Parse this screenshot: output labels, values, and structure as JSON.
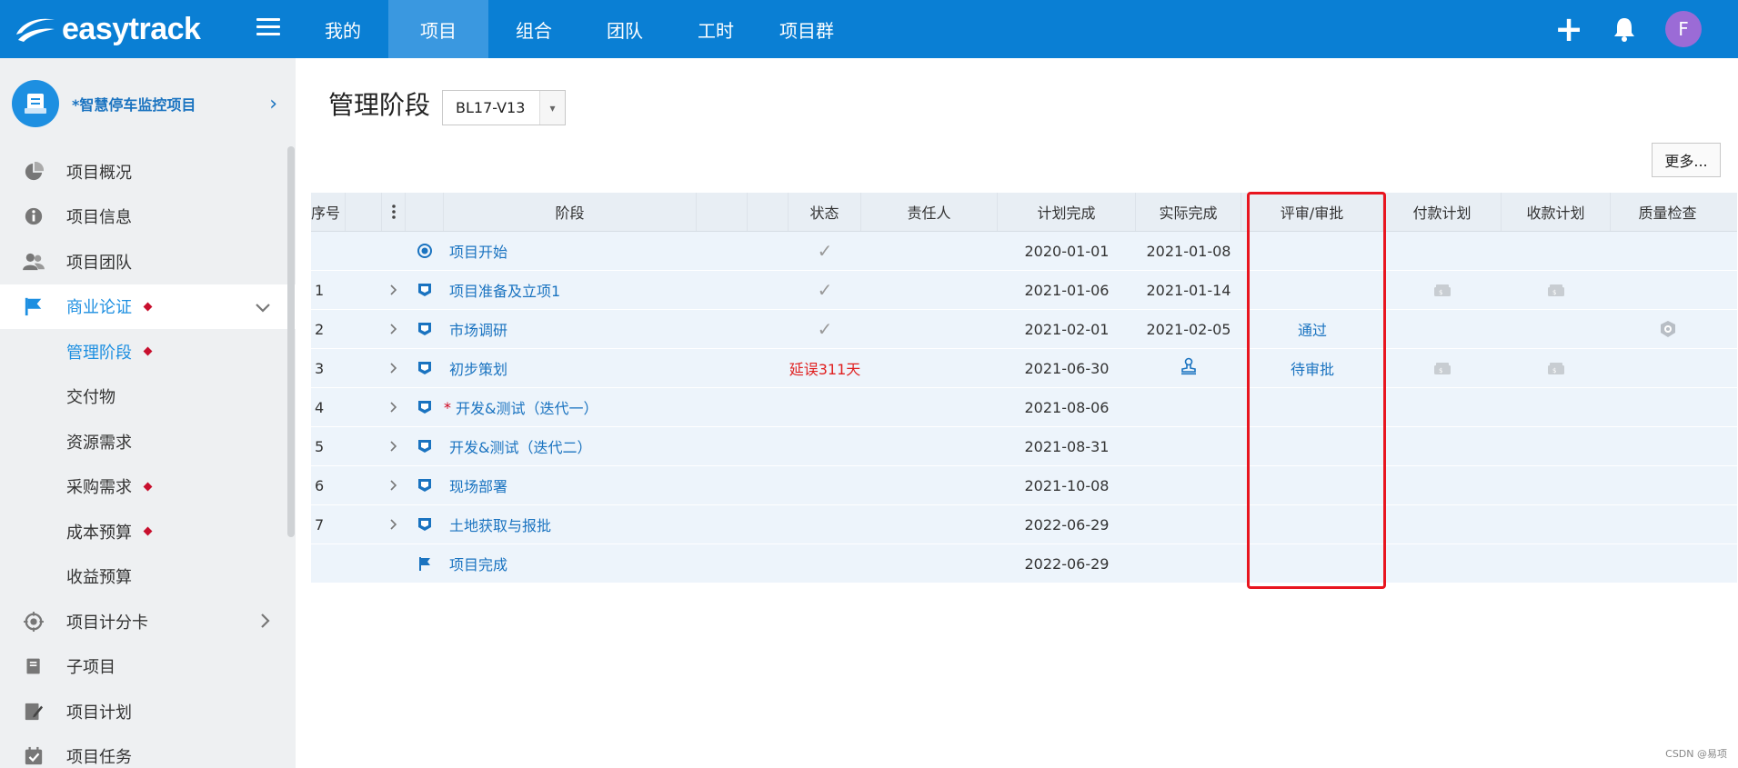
{
  "app": {
    "logo_text": "easytrack",
    "brand_color": "#0a7fd4"
  },
  "nav": {
    "items": [
      {
        "label": "我的",
        "active": false
      },
      {
        "label": "项目",
        "active": true
      },
      {
        "label": "组合",
        "active": false
      },
      {
        "label": "团队",
        "active": false
      },
      {
        "label": "工时",
        "active": false
      },
      {
        "label": "项目群",
        "active": false
      }
    ]
  },
  "user": {
    "avatar_letter": "F"
  },
  "sidebar": {
    "project_name": "*智慧停车监控项目",
    "items": [
      {
        "label": "项目概况",
        "icon": "pie-chart-icon"
      },
      {
        "label": "项目信息",
        "icon": "info-icon"
      },
      {
        "label": "项目团队",
        "icon": "team-icon"
      },
      {
        "label": "商业论证",
        "icon": "flag-icon",
        "open": true,
        "dot": true
      },
      {
        "label": "管理阶段",
        "sub": true,
        "active": true,
        "dot": true
      },
      {
        "label": "交付物",
        "sub": true
      },
      {
        "label": "资源需求",
        "sub": true
      },
      {
        "label": "采购需求",
        "sub": true,
        "dot": true
      },
      {
        "label": "成本预算",
        "sub": true,
        "dot": true
      },
      {
        "label": "收益预算",
        "sub": true
      },
      {
        "label": "项目计分卡",
        "icon": "target-icon",
        "chevron": true
      },
      {
        "label": "子项目",
        "icon": "book-icon"
      },
      {
        "label": "项目计划",
        "icon": "edit-icon"
      },
      {
        "label": "项目任务",
        "icon": "calendar-check-icon"
      }
    ]
  },
  "main": {
    "title": "管理阶段",
    "version": "BL17-V13",
    "more_label": "更多..."
  },
  "table": {
    "headers": {
      "seq": "序号",
      "stage": "阶段",
      "status": "状态",
      "owner": "责任人",
      "plan": "计划完成",
      "actual": "实际完成",
      "review": "评审/审批",
      "pay": "付款计划",
      "recv": "收款计划",
      "qc": "质量检查"
    },
    "rows": [
      {
        "seq": "",
        "stage": "项目开始",
        "stage_icon": "milestone-start-icon",
        "required": false,
        "expand": false,
        "status": "✓",
        "plan": "2020-01-01",
        "actual": "2021-01-08",
        "review": "",
        "pay": false,
        "recv": false,
        "qc": false
      },
      {
        "seq": "1",
        "stage": "项目准备及立项1",
        "stage_icon": "phase-icon",
        "required": false,
        "expand": true,
        "status": "✓",
        "plan": "2021-01-06",
        "actual": "2021-01-14",
        "review": "",
        "pay": true,
        "recv": true,
        "qc": false
      },
      {
        "seq": "2",
        "stage": "市场调研",
        "stage_icon": "phase-icon",
        "required": false,
        "expand": true,
        "status": "✓",
        "plan": "2021-02-01",
        "actual": "2021-02-05",
        "review": "通过",
        "pay": false,
        "recv": false,
        "qc": true
      },
      {
        "seq": "3",
        "stage": "初步策划",
        "stage_icon": "phase-icon",
        "required": false,
        "expand": true,
        "status": "延误311天",
        "status_delay": true,
        "plan": "2021-06-30",
        "actual": "",
        "actual_icon": true,
        "review": "待审批",
        "pay": true,
        "recv": true,
        "qc": false
      },
      {
        "seq": "4",
        "stage": "开发&测试（迭代一）",
        "stage_icon": "phase-icon",
        "required": true,
        "expand": true,
        "status": "",
        "plan": "2021-08-06",
        "actual": "",
        "review": "",
        "pay": false,
        "recv": false,
        "qc": false
      },
      {
        "seq": "5",
        "stage": "开发&测试（迭代二）",
        "stage_icon": "phase-icon",
        "required": false,
        "expand": true,
        "status": "",
        "plan": "2021-08-31",
        "actual": "",
        "review": "",
        "pay": false,
        "recv": false,
        "qc": false
      },
      {
        "seq": "6",
        "stage": "现场部署",
        "stage_icon": "phase-icon",
        "required": false,
        "expand": true,
        "status": "",
        "plan": "2021-10-08",
        "actual": "",
        "review": "",
        "pay": false,
        "recv": false,
        "qc": false
      },
      {
        "seq": "7",
        "stage": "土地获取与报批",
        "stage_icon": "phase-icon",
        "required": false,
        "expand": true,
        "status": "",
        "plan": "2022-06-29",
        "actual": "",
        "review": "",
        "pay": false,
        "recv": false,
        "qc": false
      },
      {
        "seq": "",
        "stage": "项目完成",
        "stage_icon": "milestone-flag-icon",
        "required": false,
        "expand": false,
        "status": "",
        "plan": "2022-06-29",
        "actual": "",
        "review": "",
        "pay": false,
        "recv": false,
        "qc": false
      }
    ]
  },
  "watermark": "CSDN @易项"
}
